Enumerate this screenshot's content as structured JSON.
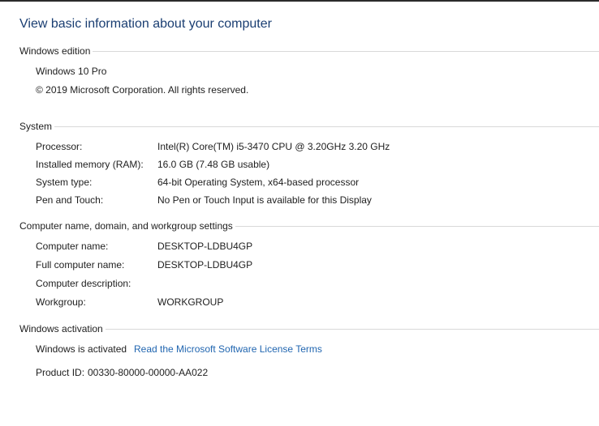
{
  "page_title": "View basic information about your computer",
  "windows_edition": {
    "heading": "Windows edition",
    "edition": "Windows 10 Pro",
    "copyright": "© 2019 Microsoft Corporation. All rights reserved."
  },
  "system": {
    "heading": "System",
    "rows": [
      {
        "label": "Processor:",
        "value": "Intel(R) Core(TM) i5-3470 CPU @ 3.20GHz   3.20 GHz"
      },
      {
        "label": "Installed memory (RAM):",
        "value": "16.0 GB (7.48 GB usable)"
      },
      {
        "label": "System type:",
        "value": "64-bit Operating System, x64-based processor"
      },
      {
        "label": "Pen and Touch:",
        "value": "No Pen or Touch Input is available for this Display"
      }
    ]
  },
  "computer_name": {
    "heading": "Computer name, domain, and workgroup settings",
    "rows": [
      {
        "label": "Computer name:",
        "value": "DESKTOP-LDBU4GP"
      },
      {
        "label": "Full computer name:",
        "value": "DESKTOP-LDBU4GP"
      },
      {
        "label": "Computer description:",
        "value": ""
      },
      {
        "label": "Workgroup:",
        "value": "WORKGROUP"
      }
    ]
  },
  "activation": {
    "heading": "Windows activation",
    "status": "Windows is activated",
    "license_link": "Read the Microsoft Software License Terms",
    "product_id_label": "Product ID:",
    "product_id": "00330-80000-00000-AA022"
  }
}
